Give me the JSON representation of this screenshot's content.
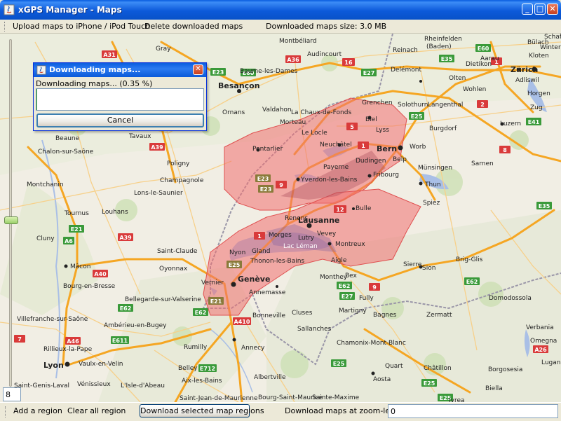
{
  "window": {
    "title": "xGPS Manager - Maps",
    "minimize": "_",
    "maximize": "□",
    "close": "✕"
  },
  "toolbar": {
    "upload_label": "Upload maps to iPhone / iPod Touch",
    "delete_label": "Delete downloaded maps",
    "size_label": "Downloaded maps size: 3.0 MB"
  },
  "dialog": {
    "title": "Downloading maps...",
    "message": "Downloading maps... (0.35 %)",
    "progress_fraction": 0.0035,
    "cancel_label": "Cancel"
  },
  "slider": {
    "value": "8"
  },
  "bottombar": {
    "add_region_label": "Add a region",
    "clear_region_label": "Clear all region",
    "download_button_label": "Download selected map regions",
    "zoom_label": "Download maps at zoom-level:",
    "zoom_value": "0"
  },
  "colors": {
    "region_fill": "#f07070",
    "road_major": "#f5a623",
    "highway_shield_red": "#d93a3a",
    "highway_shield_green": "#3a9a3a",
    "lake": "#a9bfe6",
    "border": "#9a96a8"
  },
  "map": {
    "cities": [
      {
        "name": "Besançon"
      },
      {
        "name": "Bern"
      },
      {
        "name": "Zürich"
      },
      {
        "name": "Lausanne"
      },
      {
        "name": "Genève"
      },
      {
        "name": "Lyon"
      },
      {
        "name": "Neuchâtel"
      },
      {
        "name": "Biel"
      },
      {
        "name": "Fribourg"
      },
      {
        "name": "Montreux"
      },
      {
        "name": "Annecy"
      },
      {
        "name": "Aosta"
      },
      {
        "name": "Sion"
      },
      {
        "name": "Thun"
      },
      {
        "name": "Mâcon"
      },
      {
        "name": "Pontarlier"
      },
      {
        "name": "Chalon-sur-Saône"
      },
      {
        "name": "Beaune"
      },
      {
        "name": "Lac Léman"
      },
      {
        "name": "Yverdon-les-Bains"
      },
      {
        "name": "La Chaux-de-Fonds"
      },
      {
        "name": "Solothurn"
      },
      {
        "name": "Chamonix-Mont-Blanc"
      },
      {
        "name": "Martigny"
      },
      {
        "name": "Vernier"
      },
      {
        "name": "Annemasse"
      },
      {
        "name": "Thonon-les-Bains"
      },
      {
        "name": "Morges"
      },
      {
        "name": "Nyon"
      },
      {
        "name": "Bulle"
      },
      {
        "name": "Delémont"
      },
      {
        "name": "Luzern"
      },
      {
        "name": "Rheinfelden (Baden)"
      },
      {
        "name": "Bourg-en-Bresse"
      },
      {
        "name": "Oyonnax"
      },
      {
        "name": "Lons-le-Saunier"
      },
      {
        "name": "Saint-Claude"
      },
      {
        "name": "Champagnole"
      },
      {
        "name": "Poligny"
      },
      {
        "name": "Montbéliard"
      },
      {
        "name": "Audincourt"
      },
      {
        "name": "Baume-les-Dames"
      },
      {
        "name": "Ornans"
      },
      {
        "name": "Valdahon"
      },
      {
        "name": "Morteau"
      },
      {
        "name": "Le Locle"
      },
      {
        "name": "Grenchen"
      },
      {
        "name": "Lyss"
      },
      {
        "name": "Burgdorf"
      },
      {
        "name": "Langenthal"
      },
      {
        "name": "Olten"
      },
      {
        "name": "Aarau"
      },
      {
        "name": "Reinach"
      },
      {
        "name": "Sarnen"
      },
      {
        "name": "Spiez"
      },
      {
        "name": "Münsingen"
      },
      {
        "name": "Belp"
      },
      {
        "name": "Worb"
      },
      {
        "name": "Dudingen"
      },
      {
        "name": "Payerne"
      },
      {
        "name": "Renens"
      },
      {
        "name": "Vevey"
      },
      {
        "name": "Lutry"
      },
      {
        "name": "Gland"
      },
      {
        "name": "Aigle"
      },
      {
        "name": "Monthey"
      },
      {
        "name": "Bex"
      },
      {
        "name": "Sierre"
      },
      {
        "name": "Brig-Glis"
      },
      {
        "name": "Zermatt"
      },
      {
        "name": "Domodossola"
      },
      {
        "name": "Bagnes"
      },
      {
        "name": "Fully"
      },
      {
        "name": "Cluses"
      },
      {
        "name": "Sallanches"
      },
      {
        "name": "Bonneville"
      },
      {
        "name": "Rumilly"
      },
      {
        "name": "Belley"
      },
      {
        "name": "Aix-les-Bains"
      },
      {
        "name": "Albertville"
      },
      {
        "name": "Quart"
      },
      {
        "name": "Châtillon"
      },
      {
        "name": "Borgosesia"
      },
      {
        "name": "Biella"
      },
      {
        "name": "Ivrea"
      },
      {
        "name": "Omegna"
      },
      {
        "name": "Verbania"
      },
      {
        "name": "Bellegarde-sur-Valserine"
      },
      {
        "name": "Ambérieu-en-Bugey"
      },
      {
        "name": "Villefranche-sur-Saône"
      },
      {
        "name": "Rillieux-la-Pape"
      },
      {
        "name": "Vaulx-en-Velin"
      },
      {
        "name": "Vénissieux"
      },
      {
        "name": "Saint-Genis-Laval"
      },
      {
        "name": "L'Isle-d'Abeau"
      },
      {
        "name": "Louhans"
      },
      {
        "name": "Tournus"
      },
      {
        "name": "Cluny"
      },
      {
        "name": "Montchanin"
      },
      {
        "name": "Tavaux"
      },
      {
        "name": "Gray"
      },
      {
        "name": "Sainte-Maxime"
      },
      {
        "name": "Saint-Jean-de-Maurienne"
      },
      {
        "name": "Bourg-Saint-Maurice"
      },
      {
        "name": "Lugano"
      },
      {
        "name": "Schaffhausen"
      },
      {
        "name": "Winterthur"
      },
      {
        "name": "Kloten"
      },
      {
        "name": "Bülach"
      },
      {
        "name": "Horgen"
      },
      {
        "name": "Adliswil"
      },
      {
        "name": "Dietikon"
      },
      {
        "name": "Wohlen"
      },
      {
        "name": "Zug"
      }
    ]
  }
}
